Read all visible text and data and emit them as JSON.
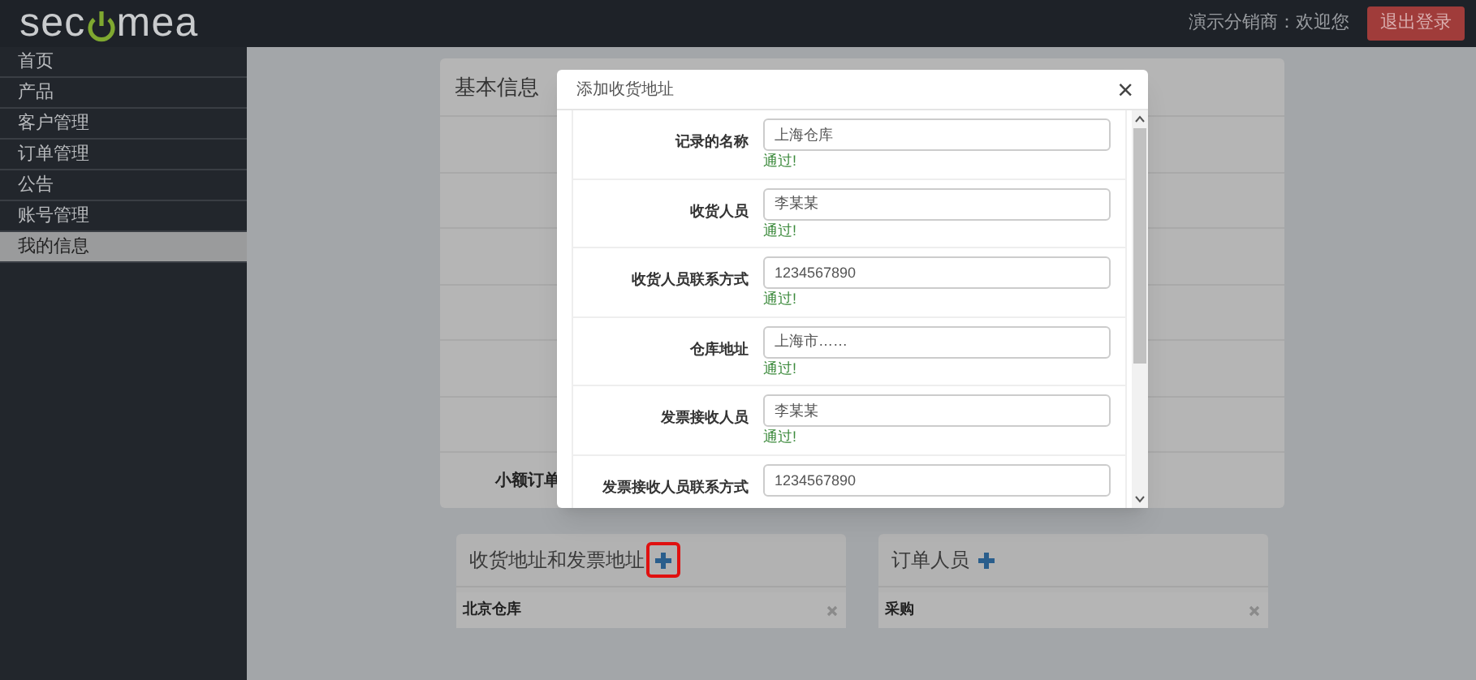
{
  "header": {
    "logo": {
      "before": "sec",
      "after": "mea"
    },
    "welcome": "演示分销商：欢迎您",
    "logout": "退出登录"
  },
  "sidebar": {
    "items": [
      {
        "label": "首页",
        "selected": false
      },
      {
        "label": "产品",
        "selected": false
      },
      {
        "label": "客户管理",
        "selected": false
      },
      {
        "label": "订单管理",
        "selected": false
      },
      {
        "label": "公告",
        "selected": false
      },
      {
        "label": "账号管理",
        "selected": false
      },
      {
        "label": "我的信息",
        "selected": true
      }
    ]
  },
  "basic_info": {
    "title": "基本信息",
    "last_row_label": "小额订单"
  },
  "panels": [
    {
      "title": "收货地址和发票地址",
      "highlighted": true,
      "items": [
        "北京仓库"
      ]
    },
    {
      "title": "订单人员",
      "highlighted": false,
      "items": [
        "采购"
      ]
    }
  ],
  "modal": {
    "title": "添加收货地址",
    "close": "×",
    "fields": [
      {
        "label": "记录的名称",
        "value": "上海仓库",
        "message": "通过!"
      },
      {
        "label": "收货人员",
        "value": "李某某",
        "message": "通过!"
      },
      {
        "label": "收货人员联系方式",
        "value": "1234567890",
        "message": "通过!"
      },
      {
        "label": "仓库地址",
        "value": "上海市……",
        "message": "通过!"
      },
      {
        "label": "发票接收人员",
        "value": "李某某",
        "message": "通过!"
      },
      {
        "label": "发票接收人员联系方式",
        "value": "1234567890"
      }
    ]
  }
}
